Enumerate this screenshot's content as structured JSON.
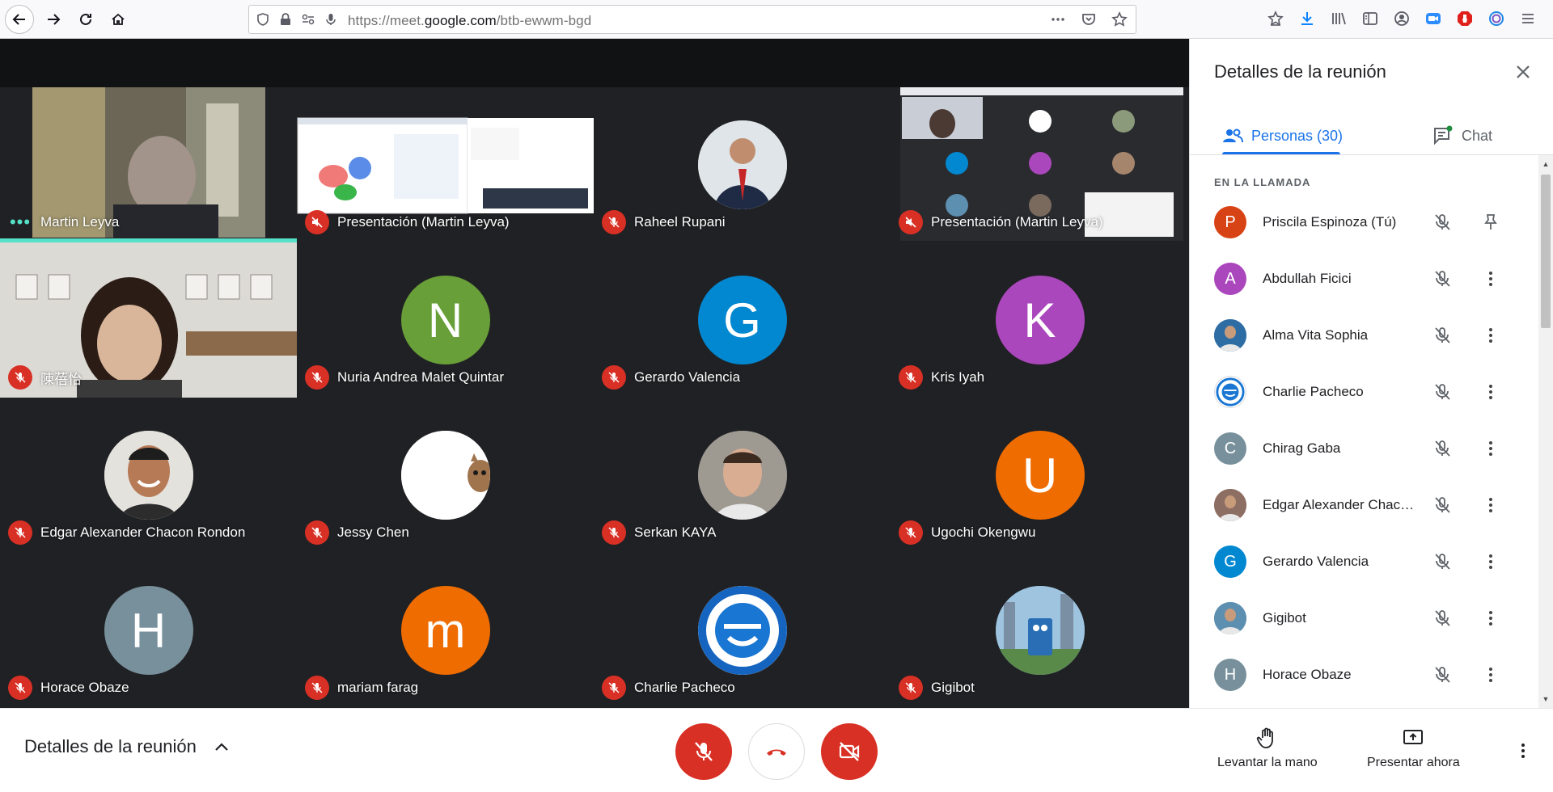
{
  "browser": {
    "url_prefix": "https://meet.",
    "url_domain": "google.com",
    "url_path": "/btb-ewwm-bgd"
  },
  "panel": {
    "title": "Detalles de la reunión",
    "tab_people": "Personas (30)",
    "tab_chat": "Chat",
    "section_label": "EN LA LLAMADA",
    "people": [
      {
        "initial": "P",
        "name": "Priscila Espinoza (Tú)",
        "color": "#d84315",
        "action": "pin-icon"
      },
      {
        "initial": "A",
        "name": "Abdullah Ficici",
        "color": "#ab47bc",
        "action": "more-vert-icon"
      },
      {
        "initial": "",
        "name": "Alma Vita Sophia",
        "color": "#2e6da4",
        "action": "more-vert-icon"
      },
      {
        "initial": "",
        "name": "Charlie Pacheco",
        "color": "#ffffff",
        "action": "more-vert-icon"
      },
      {
        "initial": "C",
        "name": "Chirag Gaba",
        "color": "#78909c",
        "action": "more-vert-icon"
      },
      {
        "initial": "",
        "name": "Edgar Alexander Chacon Rondon",
        "color": "#8d6e63",
        "action": "more-vert-icon"
      },
      {
        "initial": "G",
        "name": "Gerardo Valencia",
        "color": "#0288d1",
        "action": "more-vert-icon"
      },
      {
        "initial": "",
        "name": "Gigibot",
        "color": "#5d8fb0",
        "action": "more-vert-icon"
      },
      {
        "initial": "H",
        "name": "Horace Obaze",
        "color": "#78909c",
        "action": "more-vert-icon"
      }
    ]
  },
  "tiles": [
    {
      "name": "Martin Leyva",
      "kind": "video-person"
    },
    {
      "name": "Presentación (Martin Leyva)",
      "kind": "screen"
    },
    {
      "name": "Raheel Rupani",
      "kind": "photo"
    },
    {
      "name": "Presentación (Martin Leyva)",
      "kind": "screen-grid"
    },
    {
      "name": "陳蓓怡",
      "kind": "video-person-2"
    },
    {
      "name": "Nuria Andrea Malet Quintar",
      "initial": "N",
      "color": "#689f38"
    },
    {
      "name": "Gerardo Valencia",
      "initial": "G",
      "color": "#0288d1"
    },
    {
      "name": "Kris Iyah",
      "initial": "K",
      "color": "#ab47bc"
    },
    {
      "name": "Edgar Alexander Chacon Rondon",
      "kind": "photo"
    },
    {
      "name": "Jessy Chen",
      "kind": "cat"
    },
    {
      "name": "Serkan KAYA",
      "kind": "photo"
    },
    {
      "name": "Ugochi Okengwu",
      "initial": "U",
      "color": "#ef6c00"
    },
    {
      "name": "Horace Obaze",
      "initial": "H",
      "color": "#78909c"
    },
    {
      "name": "mariam farag",
      "initial": "m",
      "color": "#ef6c00"
    },
    {
      "name": "Charlie Pacheco",
      "kind": "logo"
    },
    {
      "name": "Gigibot",
      "kind": "photo-robot"
    }
  ],
  "bottom": {
    "details_label": "Detalles de la reunión",
    "raise_hand": "Levantar la mano",
    "present_now": "Presentar ahora"
  }
}
